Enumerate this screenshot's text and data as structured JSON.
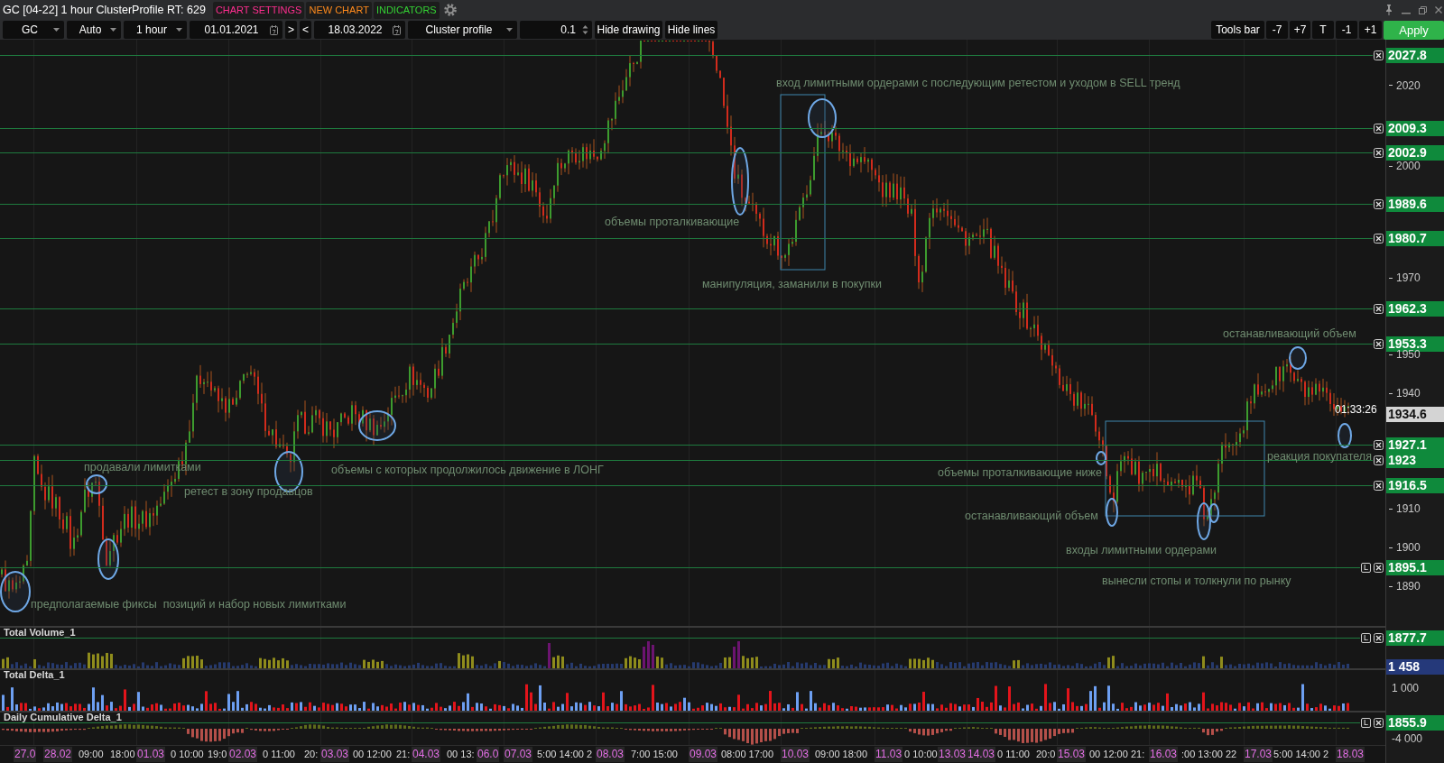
{
  "window": {
    "title": "GC [04-22] 1 hour ClusterProfile RT: 629",
    "tabs": [
      {
        "label": "CHART SETTINGS",
        "color": "#ff2d8f"
      },
      {
        "label": "NEW CHART",
        "color": "#ff8a1c"
      },
      {
        "label": "INDICATORS",
        "color": "#34d234"
      }
    ]
  },
  "toolbar": {
    "controls": [
      {
        "kind": "dropdown",
        "value": "GC"
      },
      {
        "kind": "dropdown",
        "value": "Auto"
      },
      {
        "kind": "dropdown",
        "value": "1 hour"
      },
      {
        "kind": "date",
        "value": "01.01.2021"
      },
      {
        "kind": "button",
        "label": ">"
      },
      {
        "kind": "button",
        "label": "<"
      },
      {
        "kind": "date",
        "value": "18.03.2022"
      },
      {
        "kind": "dropdown",
        "value": "Cluster profile"
      },
      {
        "kind": "spinner",
        "value": "0.1"
      },
      {
        "kind": "button",
        "label": "Hide drawing"
      },
      {
        "kind": "button",
        "label": "Hide lines"
      }
    ],
    "right_buttons": [
      {
        "kind": "button",
        "label": "Tools bar"
      },
      {
        "kind": "button",
        "label": "-7"
      },
      {
        "kind": "button",
        "label": "+7"
      },
      {
        "kind": "button",
        "label": "T"
      },
      {
        "kind": "button",
        "label": "-1"
      },
      {
        "kind": "button",
        "label": "+1"
      },
      {
        "kind": "primary",
        "label": "Apply"
      }
    ]
  },
  "price_chart": {
    "axis_ticks": [
      "2020",
      "2000",
      "1970",
      "1950",
      "1940",
      "1910",
      "1900",
      "1890"
    ],
    "levels": [
      {
        "label": "2027.8"
      },
      {
        "label": "2009.3"
      },
      {
        "label": "2002.9"
      },
      {
        "label": "1989.6"
      },
      {
        "label": "1980.7"
      },
      {
        "label": "1962.3"
      },
      {
        "label": "1953.3"
      },
      {
        "label": "1927.1"
      },
      {
        "label": "1923"
      },
      {
        "label": "1916.5"
      },
      {
        "label": "1895.1",
        "tag": "L"
      }
    ],
    "current_price": "1934.6",
    "timer": "01:33:26",
    "annotations": [
      "вход лимитными ордерами с последующим ретестом и уходом в SELL тренд",
      "объемы проталкивающие",
      "манипуляция, заманили в покупки",
      "останавливающий объем",
      "реакция покупателя",
      "продавали лимитками",
      "объемы с которых продолжилось движение в ЛОНГ",
      "объемы проталкивающие ниже",
      "ретест в зону продавцов",
      "останавливающий объем",
      "входы лимитными ордерами",
      "вынесли стопы и толкнули по рынку",
      "предполагаемые фиксы  позиций и набор новых лимитками"
    ]
  },
  "indicators": [
    {
      "title": "Total Volume_1",
      "kind": "volume",
      "line_label": "1877.7",
      "tag": "L",
      "value_label": "1 458"
    },
    {
      "title": "Total Delta_1",
      "kind": "delta",
      "axis_tick": "1 000"
    },
    {
      "title": "Daily Cumulative Delta_1",
      "kind": "cumulative_delta",
      "line_label": "1855.9",
      "tag": "L",
      "axis_tick": "-4 000"
    }
  ],
  "time_axis": [
    {
      "label": "27.0",
      "kind": "date"
    },
    {
      "label": "28.02",
      "kind": "date"
    },
    {
      "label": "09:00",
      "kind": "time"
    },
    {
      "label": "18:00",
      "kind": "time"
    },
    {
      "label": "01.03",
      "kind": "date"
    },
    {
      "label": "0 10:00",
      "kind": "time"
    },
    {
      "label": "19:0",
      "kind": "time"
    },
    {
      "label": "02.03",
      "kind": "date"
    },
    {
      "label": "0 11:00",
      "kind": "time"
    },
    {
      "label": "20:",
      "kind": "time"
    },
    {
      "label": "03.03",
      "kind": "date"
    },
    {
      "label": "00 12:00",
      "kind": "time"
    },
    {
      "label": "21:",
      "kind": "time"
    },
    {
      "label": "04.03",
      "kind": "date"
    },
    {
      "label": "00 13:",
      "kind": "time"
    },
    {
      "label": "06.0",
      "kind": "date"
    },
    {
      "label": "07.03",
      "kind": "date"
    },
    {
      "label": "5:00 14:00 2",
      "kind": "time"
    },
    {
      "label": "08.03",
      "kind": "date"
    },
    {
      "label": "7:00 15:00",
      "kind": "time"
    },
    {
      "label": "09.03",
      "kind": "date"
    },
    {
      "label": "08:00 17:00",
      "kind": "time"
    },
    {
      "label": "10.03",
      "kind": "date"
    },
    {
      "label": "09:00 18:00",
      "kind": "time"
    },
    {
      "label": "11.03",
      "kind": "date"
    },
    {
      "label": "0 10:00",
      "kind": "time"
    },
    {
      "label": "13.03",
      "kind": "date"
    },
    {
      "label": "14.03",
      "kind": "date"
    },
    {
      "label": "0 11:00",
      "kind": "time"
    },
    {
      "label": "20:0",
      "kind": "time"
    },
    {
      "label": "15.03",
      "kind": "date"
    },
    {
      "label": "00 12:00",
      "kind": "time"
    },
    {
      "label": "21:",
      "kind": "time"
    },
    {
      "label": "16.03",
      "kind": "date"
    },
    {
      "label": ":00 13:00 22",
      "kind": "time"
    },
    {
      "label": "17.03",
      "kind": "date"
    },
    {
      "label": "5:00 14:00 2",
      "kind": "time"
    },
    {
      "label": "18.03",
      "kind": "date"
    }
  ]
}
